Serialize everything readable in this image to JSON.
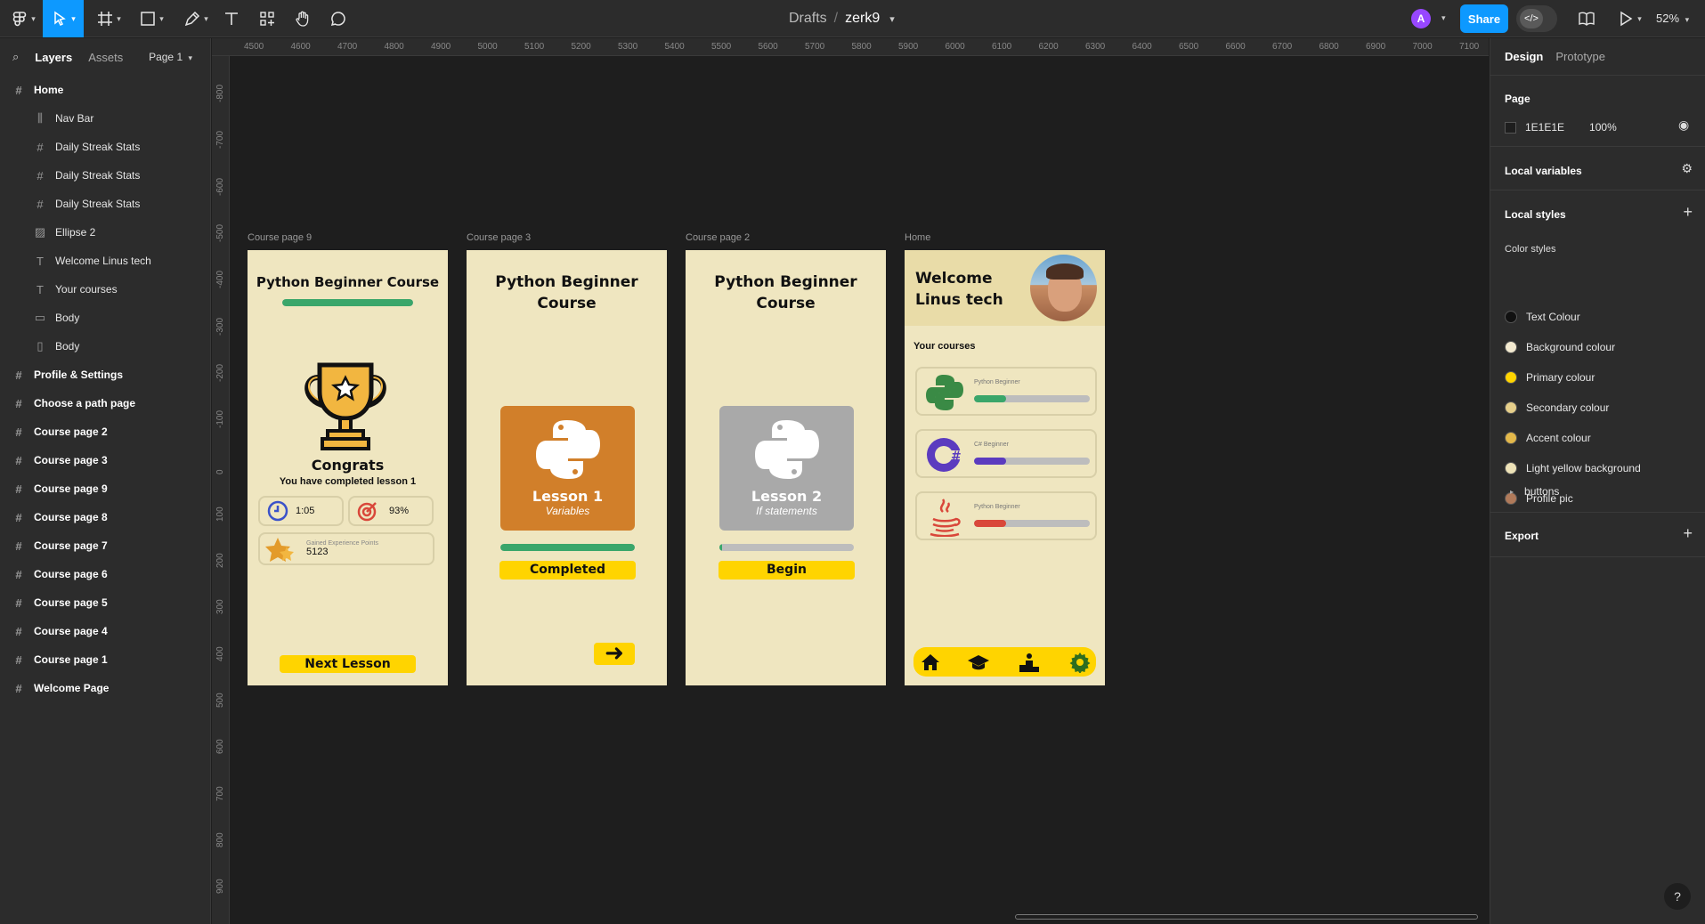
{
  "toolbar": {
    "breadcrumb_folder": "Drafts",
    "breadcrumb_sep": "/",
    "file_name": "zerk9",
    "avatar_letter": "A",
    "share_label": "Share",
    "dev_label": "</>",
    "zoom": "52%"
  },
  "left_panel": {
    "tab_layers": "Layers",
    "tab_assets": "Assets",
    "page_selector": "Page 1",
    "layers": [
      {
        "label": "Home",
        "level": "top",
        "icon": "#"
      },
      {
        "label": "Nav Bar",
        "level": "child",
        "icon": "|||"
      },
      {
        "label": "Daily Streak Stats",
        "level": "child",
        "icon": "#"
      },
      {
        "label": "Daily Streak Stats",
        "level": "child",
        "icon": "#"
      },
      {
        "label": "Daily Streak Stats",
        "level": "child",
        "icon": "#"
      },
      {
        "label": "Ellipse 2",
        "level": "child",
        "icon": "img"
      },
      {
        "label": "Welcome Linus tech",
        "level": "child",
        "icon": "T"
      },
      {
        "label": "Your courses",
        "level": "child",
        "icon": "T"
      },
      {
        "label": "Body",
        "level": "child",
        "icon": "rect"
      },
      {
        "label": "Body",
        "level": "child",
        "icon": "rect-v"
      },
      {
        "label": "Profile & Settings",
        "level": "top",
        "icon": "#"
      },
      {
        "label": "Choose a path page",
        "level": "top",
        "icon": "#"
      },
      {
        "label": "Course page 2",
        "level": "top",
        "icon": "#"
      },
      {
        "label": "Course page 3",
        "level": "top",
        "icon": "#"
      },
      {
        "label": "Course page 9",
        "level": "top",
        "icon": "#"
      },
      {
        "label": "Course page 8",
        "level": "top",
        "icon": "#"
      },
      {
        "label": "Course page 7",
        "level": "top",
        "icon": "#"
      },
      {
        "label": "Course page 6",
        "level": "top",
        "icon": "#"
      },
      {
        "label": "Course page 5",
        "level": "top",
        "icon": "#"
      },
      {
        "label": "Course page 4",
        "level": "top",
        "icon": "#"
      },
      {
        "label": "Course page 1",
        "level": "top",
        "icon": "#"
      },
      {
        "label": "Welcome Page",
        "level": "top",
        "icon": "#"
      }
    ]
  },
  "ruler": {
    "top_ticks": [
      "4500",
      "4600",
      "4700",
      "4800",
      "4900",
      "5000",
      "5100",
      "5200",
      "5300",
      "5400",
      "5500",
      "5600",
      "5700",
      "5800",
      "5900",
      "6000",
      "6100",
      "6200",
      "6300",
      "6400",
      "6500",
      "6600",
      "6700",
      "6800",
      "6900",
      "7000",
      "7100"
    ],
    "left_ticks": [
      "-800",
      "-700",
      "-600",
      "-500",
      "-400",
      "-300",
      "-200",
      "-100",
      "0",
      "100",
      "200",
      "300",
      "400",
      "500",
      "600",
      "700",
      "800",
      "900"
    ]
  },
  "canvas": {
    "frame9": {
      "label": "Course page 9",
      "title": "Python Beginner Course",
      "progress": 1.0,
      "congrats": "Congrats",
      "completed_text": "You have completed lesson 1",
      "time_value": "1:05",
      "accuracy_value": "93%",
      "xp_label": "Gained Experience Points",
      "xp_value": "5123",
      "next_button": "Next Lesson"
    },
    "frame3": {
      "label": "Course page 3",
      "title_line1": "Python Beginner",
      "title_line2": "Course",
      "lesson_title": "Lesson 1",
      "lesson_subtitle": "Variables",
      "progress": 1.0,
      "status_button": "Completed",
      "arrow": "➜"
    },
    "frame2": {
      "label": "Course page 2",
      "title_line1": "Python Beginner",
      "title_line2": "Course",
      "lesson_title": "Lesson 2",
      "lesson_subtitle": "If statements",
      "progress": 0.02,
      "status_button": "Begin"
    },
    "home": {
      "label": "Home",
      "welcome_line1": "Welcome",
      "welcome_line2": "Linus tech",
      "your_courses": "Your courses",
      "courses": [
        {
          "name": "Python Beginner",
          "progress": 0.28,
          "color": "#3aa66a",
          "icon": "python-logo-icon"
        },
        {
          "name": "C# Beginner",
          "progress": 0.28,
          "color": "#5b3bbf",
          "icon": "csharp-logo-icon"
        },
        {
          "name": "Python Beginner",
          "progress": 0.28,
          "color": "#d9473a",
          "icon": "java-logo-icon"
        }
      ],
      "nav_icons": [
        "home-icon",
        "graduation-cap-icon",
        "leaderboard-icon",
        "settings-gear-icon"
      ]
    }
  },
  "right_panel": {
    "tab_design": "Design",
    "tab_prototype": "Prototype",
    "page_section": "Page",
    "page_color": "1E1E1E",
    "page_opacity": "100%",
    "local_variables": "Local variables",
    "local_styles": "Local styles",
    "color_styles_heading": "Color styles",
    "color_styles": [
      {
        "name": "Text Colour",
        "color": "#111111"
      },
      {
        "name": "Background colour",
        "color": "#f3ead0"
      },
      {
        "name": "Primary colour",
        "color": "#ffd400"
      },
      {
        "name": "Secondary colour",
        "color": "#e6cf8a"
      },
      {
        "name": "Accent colour",
        "color": "#e3b84a"
      },
      {
        "name": "Light yellow background",
        "color": "#eee3b8"
      },
      {
        "name": "Profile pic",
        "color": "#b07a5a"
      }
    ],
    "buttons_group": "buttons",
    "export": "Export",
    "help": "?"
  }
}
